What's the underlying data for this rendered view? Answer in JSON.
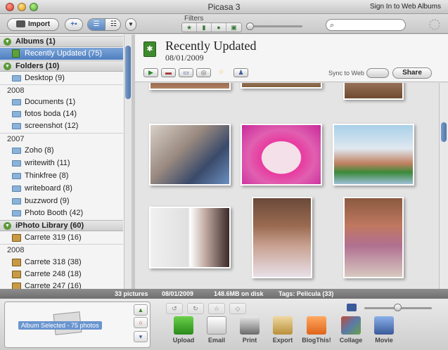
{
  "window": {
    "title": "Picasa 3",
    "sign_in": "Sign In to Web Albums"
  },
  "toolbar": {
    "import_label": "Import",
    "filters_label": "Filters",
    "search_placeholder": ""
  },
  "sidebar": {
    "sections": [
      {
        "label": "Albums (1)"
      },
      {
        "label": "Folders (10)"
      },
      {
        "label": "iPhoto Library (60)"
      }
    ],
    "albums": [
      {
        "label": "Recently Updated (75)",
        "selected": true
      }
    ],
    "folders_top": [
      {
        "label": "Desktop (9)"
      }
    ],
    "years": [
      "2008",
      "2007",
      "2008"
    ],
    "folders_2008": [
      {
        "label": "Documents (1)"
      },
      {
        "label": "fotos boda (14)"
      },
      {
        "label": "screenshot (12)"
      }
    ],
    "folders_2007": [
      {
        "label": "Zoho (8)"
      },
      {
        "label": "writewith (11)"
      },
      {
        "label": "Thinkfree (8)"
      },
      {
        "label": "writeboard (8)"
      },
      {
        "label": "buzzword (9)"
      },
      {
        "label": "Photo Booth (42)"
      }
    ],
    "iphoto_top": [
      {
        "label": "Carrete 319 (16)"
      }
    ],
    "iphoto_2008": [
      {
        "label": "Carrete 318 (38)"
      },
      {
        "label": "Carrete 248 (18)"
      },
      {
        "label": "Carrete 247 (16)"
      }
    ]
  },
  "album": {
    "title": "Recently Updated",
    "date": "08/01/2009",
    "sync_label": "Sync to Web",
    "share_label": "Share"
  },
  "status": {
    "pictures": "33 pictures",
    "date": "08/01/2009",
    "disk": "148.6MB on disk",
    "tags": "Tags: Pelicula (33)"
  },
  "tray": {
    "selection_label": "Album Selected - 75 photos",
    "tools": [
      {
        "label": "Upload",
        "icon": "upload-icon",
        "color": "#3a9a2a"
      },
      {
        "label": "Email",
        "icon": "email-icon",
        "color": "#d8d8d8"
      },
      {
        "label": "Print",
        "icon": "print-icon",
        "color": "#7a7a7a"
      },
      {
        "label": "Export",
        "icon": "export-icon",
        "color": "#c9a86a"
      },
      {
        "label": "BlogThis!",
        "icon": "blogger-icon",
        "color": "#e8782a"
      },
      {
        "label": "Collage",
        "icon": "collage-icon",
        "color": "#5a7aa8"
      },
      {
        "label": "Movie",
        "icon": "movie-icon",
        "color": "#4a6aa0"
      }
    ]
  },
  "colors": {
    "selection": "#5a88c4",
    "section_icon": "#5d9a3a",
    "status_bar": "#7d7d7d"
  }
}
